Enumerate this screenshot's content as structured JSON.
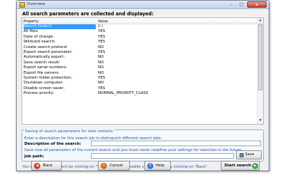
{
  "window": {
    "title": "Overview"
  },
  "heading": "All search parameters are collected and displayed:",
  "list": {
    "col_property": "Property:",
    "col_value": "Value:",
    "rows": [
      {
        "property": "Search folder1:",
        "value": "C:\\"
      },
      {
        "property": "All files:",
        "value": "YES"
      },
      {
        "property": "Date of change:",
        "value": "YES"
      },
      {
        "property": "Wildcard search:",
        "value": "YES"
      },
      {
        "property": "Create search protocol",
        "value": "NO"
      },
      {
        "property": "Export search parameter:",
        "value": "YES"
      },
      {
        "property": "Automatically export:",
        "value": "NO"
      },
      {
        "property": "Save search result:",
        "value": "NO"
      },
      {
        "property": "Export serial numbers:",
        "value": "NO"
      },
      {
        "property": "Export file owners:",
        "value": "NO"
      },
      {
        "property": "System folder protection:",
        "value": "YES"
      },
      {
        "property": "Shutdown computer:",
        "value": "NO"
      },
      {
        "property": "Disable screen saver:",
        "value": "YES"
      },
      {
        "property": "Process priority:",
        "value": "NORMAL_PRIORITY_CLASS"
      }
    ]
  },
  "save_group": {
    "title": "Saving of search parameters for later restarts:",
    "hint_description": "Enter a description for this search job to distinguish different search jobs.",
    "description_label": "Description of the search:",
    "description_value": "",
    "hint_path": "Save now all parameters of the current search and you must never redefine your settings for searches in the future.",
    "path_label": "Job path:",
    "path_value": "",
    "save_as_label": "Save as..."
  },
  "footer_note": "You can start the search by clicking on \"Start search\" or modify your settings by clicking on \"Back\".",
  "buttons": {
    "back": "Back",
    "cancel": "Cancel",
    "help": "Help",
    "start": "Start search"
  },
  "colors": {
    "selection": "#3399ff",
    "accent_text": "#1c5aa6",
    "back_icon": "#d23a2a",
    "cancel_icon": "#d2692a",
    "help_icon": "#3a7bd2",
    "start_icon": "#3aa84a"
  }
}
